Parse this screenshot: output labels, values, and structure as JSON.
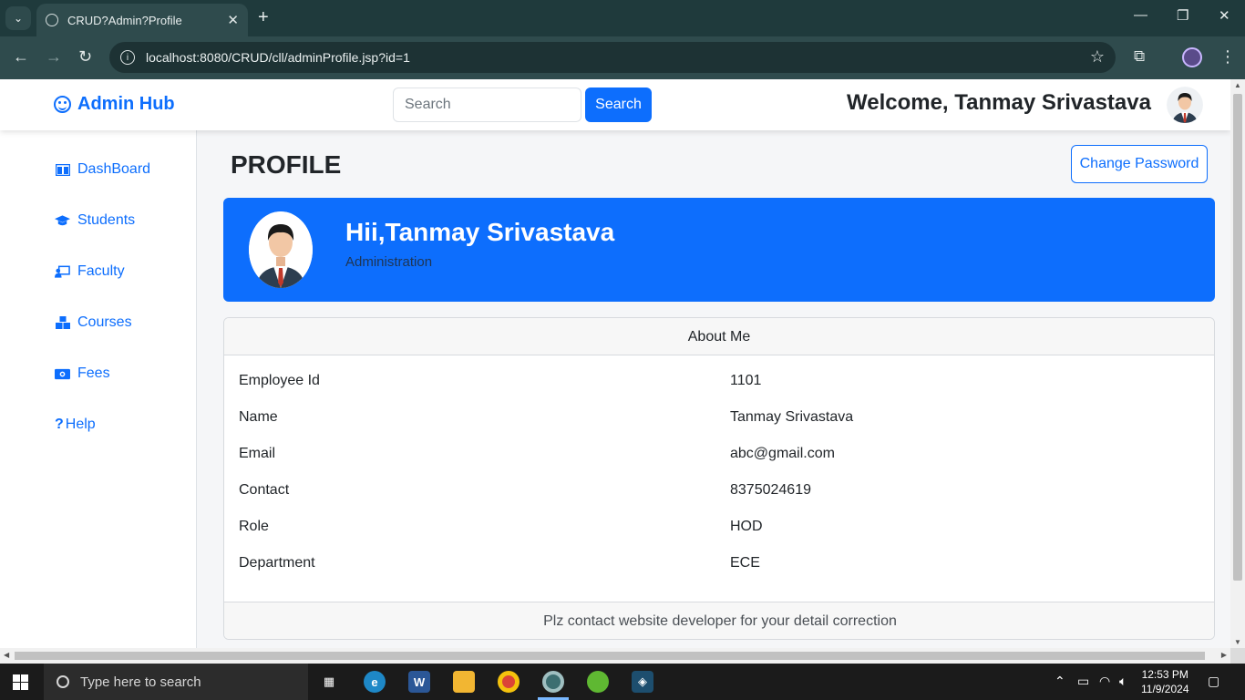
{
  "browser": {
    "tab_title": "CRUD?Admin?Profile",
    "url": "localhost:8080/CRUD/cll/adminProfile.jsp?id=1"
  },
  "topnav": {
    "brand": "Admin Hub",
    "search_placeholder": "Search",
    "search_button": "Search",
    "welcome": "Welcome, Tanmay Srivastava"
  },
  "sidebar": {
    "items": [
      {
        "label": "DashBoard",
        "icon": "layout-icon"
      },
      {
        "label": "Students",
        "icon": "graduation-cap-icon"
      },
      {
        "label": "Faculty",
        "icon": "teacher-board-icon"
      },
      {
        "label": "Courses",
        "icon": "boxes-icon"
      },
      {
        "label": "Fees",
        "icon": "money-icon"
      },
      {
        "label": "Help",
        "icon": "question-icon"
      }
    ]
  },
  "main": {
    "title": "PROFILE",
    "change_password": "Change Password",
    "hero": {
      "greeting": "Hii,Tanmay Srivastava",
      "role": "Administration"
    },
    "about": {
      "header": "About Me",
      "rows": [
        {
          "label": "Employee Id",
          "value": "1101"
        },
        {
          "label": "Name",
          "value": "Tanmay Srivastava"
        },
        {
          "label": "Email",
          "value": "abc@gmail.com"
        },
        {
          "label": "Contact",
          "value": "8375024619"
        },
        {
          "label": "Role",
          "value": "HOD"
        },
        {
          "label": "Department",
          "value": "ECE"
        }
      ],
      "footer": "Plz contact website developer for your detail correction"
    }
  },
  "taskbar": {
    "search_placeholder": "Type here to search",
    "time": "12:53 PM",
    "date": "11/9/2024"
  },
  "colors": {
    "primary": "#0d6efd",
    "chrome": "#1f3a3c"
  }
}
